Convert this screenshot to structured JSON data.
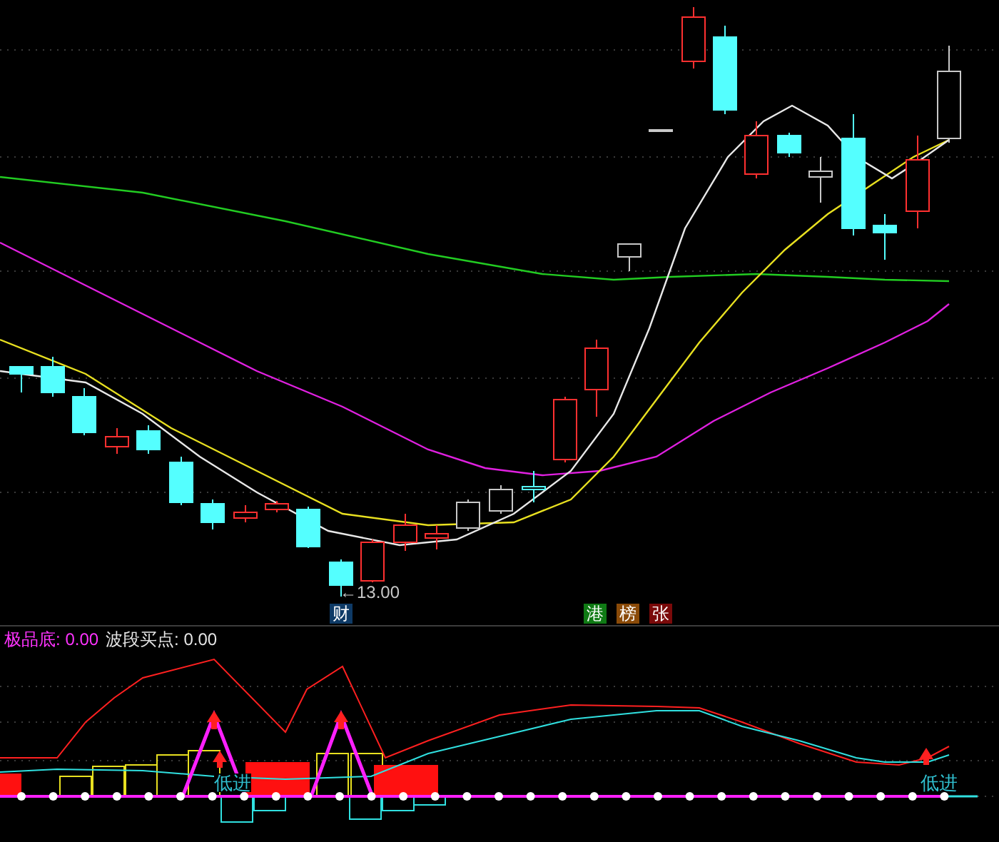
{
  "main_chart": {
    "low_marker": "←13.00",
    "badges": [
      {
        "text": "财",
        "color": "#0e3a66"
      },
      {
        "text": "港",
        "color": "#0f7a14"
      },
      {
        "text": "榜",
        "color": "#8a4a08"
      },
      {
        "text": "张",
        "color": "#7a0a0a"
      }
    ]
  },
  "indicator": {
    "legend": [
      {
        "label": "极品底:",
        "value": "0.00",
        "color": "#ff33ff"
      },
      {
        "label": "波段买点:",
        "value": "0.00",
        "color": "#e6e6e6"
      }
    ],
    "signals": [
      "低进",
      "低进"
    ]
  }
}
